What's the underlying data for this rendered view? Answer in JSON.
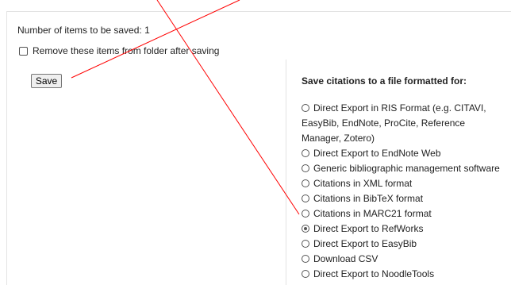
{
  "save_dialog": {
    "count_label": "Number of items to be saved:",
    "count_value": "1",
    "remove_checkbox_label": "Remove these items from folder after saving",
    "remove_checked": false,
    "save_button_label": "Save"
  },
  "citation_panel": {
    "heading": "Save citations to a file formatted for:",
    "options": [
      {
        "label": "Direct Export in RIS Format (e.g. CITAVI, EasyBib, EndNote, ProCite, Reference Manager, Zotero)",
        "checked": false
      },
      {
        "label": "Direct Export to EndNote Web",
        "checked": false
      },
      {
        "label": "Generic bibliographic management software",
        "checked": false
      },
      {
        "label": "Citations in XML format",
        "checked": false
      },
      {
        "label": "Citations in BibTeX format",
        "checked": false
      },
      {
        "label": "Citations in MARC21 format",
        "checked": false
      },
      {
        "label": "Direct Export to RefWorks",
        "checked": true
      },
      {
        "label": "Direct Export to EasyBib",
        "checked": false
      },
      {
        "label": "Download CSV",
        "checked": false
      },
      {
        "label": "Direct Export to NoodleTools",
        "checked": false
      }
    ]
  },
  "annotation": {
    "color": "#ff0000"
  }
}
